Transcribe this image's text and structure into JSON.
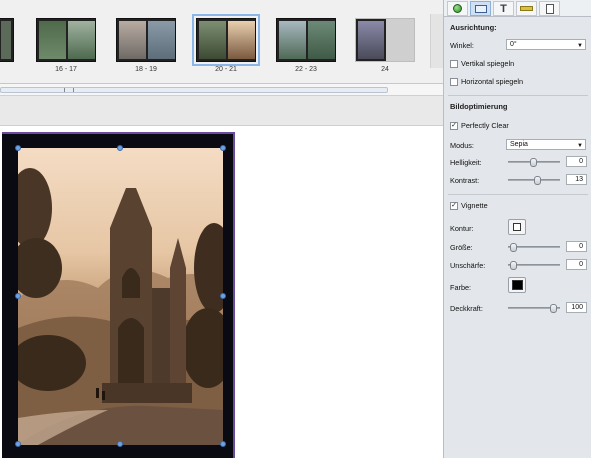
{
  "thumbnails": [
    {
      "label": "",
      "colors": [
        "#5c6a5a",
        "#3d4a3c"
      ]
    },
    {
      "label": "16 - 17",
      "colors": [
        "#6f8a6a",
        "#8aa07f"
      ]
    },
    {
      "label": "18 - 19",
      "colors": [
        "#9a8e86",
        "#7d8c98"
      ]
    },
    {
      "label": "20 - 21",
      "colors": [
        "#55624d",
        "#a88a6a"
      ]
    },
    {
      "label": "22 - 23",
      "colors": [
        "#6d8a78",
        "#4f6a56"
      ]
    },
    {
      "label": "24",
      "colors": [
        "#6a6a80",
        "#cfcfcf"
      ]
    }
  ],
  "panel": {
    "tabs": [
      {
        "name": "tab-effects",
        "icon": "🟢"
      },
      {
        "name": "tab-frame",
        "icon": "▭"
      },
      {
        "name": "tab-text",
        "icon": "T"
      },
      {
        "name": "tab-ruler",
        "icon": "▬"
      },
      {
        "name": "tab-page",
        "icon": "🗋"
      }
    ],
    "ausrichtung": {
      "title": "Ausrichtung:",
      "winkel_label": "Winkel:",
      "winkel_value": "0°",
      "vertikal_label": "Vertikal spiegeln",
      "horizontal_label": "Horizontal spiegeln"
    },
    "bildoptimierung": {
      "title": "Bildoptimierung",
      "perfectly_clear_label": "Perfectly Clear",
      "perfectly_clear_checked": "✓",
      "modus_label": "Modus:",
      "modus_value": "Sepia",
      "helligkeit_label": "Helligkeit:",
      "helligkeit_value": "0",
      "kontrast_label": "Kontrast:",
      "kontrast_value": "13"
    },
    "vignette": {
      "label": "Vignette",
      "checked": "✓",
      "kontur_label": "Kontur:",
      "groesse_label": "Größe:",
      "groesse_value": "0",
      "unschaerfe_label": "Unschärfe:",
      "unschaerfe_value": "0",
      "farbe_label": "Farbe:",
      "farbe_color": "#000000",
      "deckkraft_label": "Deckkraft:",
      "deckkraft_value": "100"
    }
  }
}
